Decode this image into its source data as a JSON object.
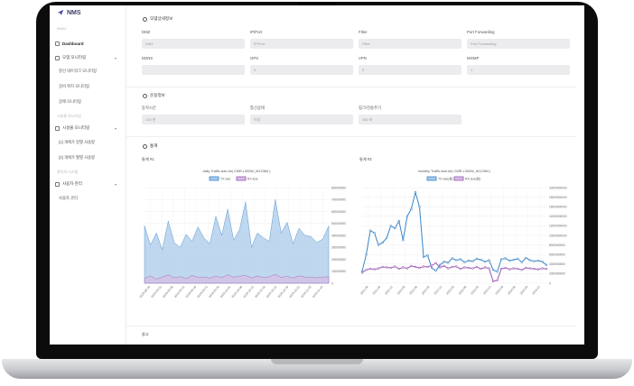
{
  "app": {
    "name": "NMS"
  },
  "sidebar": {
    "sections": [
      "MAIN",
      "시설물 모니터링",
      "관리자 시스템"
    ],
    "items": [
      {
        "label": "Dashboard"
      },
      {
        "label": "모뎀 모니터링"
      },
      {
        "label": "시설물 모니터링"
      },
      {
        "label": "사용자 관리"
      }
    ],
    "subitems": [
      "항선 네트워크 모니터링",
      "장비 위치 모니터링",
      "장애 모니터링",
      "[1] 개체가 일별 사용량",
      "[2] 개체가 월별 사용량",
      "사용자 관리"
    ]
  },
  "device_info": {
    "title": "모뎀상세정보",
    "fields": [
      {
        "label": "DMZ",
        "value": "DMZ"
      },
      {
        "label": "IP/Port",
        "value": "IP/Port"
      },
      {
        "label": "Filter",
        "value": "Filter"
      },
      {
        "label": "Port Forwarding",
        "value": "Port Forwarding"
      },
      {
        "label": "DDNS",
        "value": "..."
      },
      {
        "label": "GPS",
        "value": "0"
      },
      {
        "label": "VPN",
        "value": "0"
      },
      {
        "label": "MGMP",
        "value": "1"
      }
    ]
  },
  "operation": {
    "title": "운용정보",
    "fields": [
      {
        "label": "동작시간",
        "value": "120 분"
      },
      {
        "label": "통신상태",
        "value": "이상"
      },
      {
        "label": "링크/전송주기",
        "value": "180 초"
      }
    ]
  },
  "stats": {
    "title": "통계",
    "chart1_label": "통계 #1",
    "chart2_label": "통계 #2",
    "notes_label": "참고"
  },
  "colors": {
    "tx": "#3a86c8",
    "rx": "#9b59b6",
    "tx_fill": "#a9c9ea",
    "rx_fill": "#d6bfe4"
  },
  "chart_data": [
    {
      "type": "area",
      "title": "daily Traffic size-kb( CMR-L300W_W12384 )",
      "legend": [
        "TX size",
        "RX size"
      ],
      "legend_position": "top",
      "ylim": [
        0,
        800000000
      ],
      "yticks": [
        "800000000",
        "700000000",
        "600000000",
        "500000000",
        "400000000",
        "300000000",
        "200000000",
        "100000000",
        "0"
      ],
      "x_tick_labels": [
        "2024-08-26",
        "2024-09-01",
        "2024-09-06",
        "2024-09-11",
        "2024-09-16",
        "2024-09-21",
        "2024-09-26",
        "2024-10-01",
        "2024-10-06",
        "2024-10-11",
        "2024-10-16",
        "2024-10-21",
        "2024-10-26",
        "2024-10-31",
        "2024-11-05",
        "2024-11-10"
      ],
      "series": [
        {
          "name": "TX size",
          "values": [
            480000000,
            320000000,
            420000000,
            280000000,
            520000000,
            340000000,
            300000000,
            410000000,
            350000000,
            470000000,
            380000000,
            330000000,
            560000000,
            400000000,
            620000000,
            360000000,
            450000000,
            680000000,
            300000000,
            420000000,
            380000000,
            350000000,
            700000000,
            420000000,
            510000000,
            330000000,
            460000000,
            400000000,
            390000000,
            340000000,
            370000000,
            480000000
          ]
        },
        {
          "name": "RX size",
          "values": [
            40000000,
            60000000,
            35000000,
            50000000,
            70000000,
            45000000,
            55000000,
            38000000,
            65000000,
            48000000,
            52000000,
            42000000,
            60000000,
            46000000,
            72000000,
            50000000,
            58000000,
            66000000,
            44000000,
            61000000,
            47000000,
            53000000,
            75000000,
            49000000,
            57000000,
            43000000,
            62000000,
            51000000,
            48000000,
            45000000,
            50000000,
            55000000
          ]
        }
      ]
    },
    {
      "type": "line",
      "title": "monthly Traffic size-kb( CMR-L300W_W12384 )",
      "legend": [
        "TX size(월)",
        "RX size(월)"
      ],
      "legend_position": "top",
      "ylim": [
        0,
        20000000000
      ],
      "yticks": [
        "20000000000",
        "18000000000",
        "16000000000",
        "14000000000",
        "12000000000",
        "10000000000",
        "8000000000",
        "6000000000",
        "4000000000",
        "2000000000",
        "0"
      ],
      "x_tick_labels": [
        "2021-06",
        "2021-09",
        "2021-12",
        "2022-03",
        "2022-06",
        "2022-09",
        "2022-12",
        "2023-03",
        "2023-06",
        "2023-09",
        "2023-12",
        "2024-03",
        "2024-06",
        "2024-09",
        "2024-12"
      ],
      "series": [
        {
          "name": "TX size(월)",
          "values": [
            2500000000,
            6000000000,
            11000000000,
            10500000000,
            8000000000,
            8500000000,
            9500000000,
            12000000000,
            11500000000,
            13000000000,
            9000000000,
            14000000000,
            15500000000,
            19000000000,
            16000000000,
            5500000000,
            5800000000,
            3200000000,
            2600000000,
            3800000000,
            4500000000,
            4300000000,
            5200000000,
            4800000000,
            5000000000,
            4400000000,
            4700000000,
            4600000000,
            5100000000,
            4900000000,
            4500000000,
            4800000000,
            2800000000,
            2400000000,
            5000000000,
            5200000000,
            4700000000,
            4900000000,
            5100000000,
            4400000000,
            5300000000,
            4800000000,
            4600000000,
            4700000000,
            4500000000,
            3800000000
          ]
        },
        {
          "name": "RX size(월)",
          "values": [
            2200000000,
            2800000000,
            3000000000,
            2900000000,
            3100000000,
            3400000000,
            3300000000,
            3200000000,
            3500000000,
            3000000000,
            3300000000,
            3100000000,
            3600000000,
            3400000000,
            3200000000,
            3500000000,
            3400000000,
            3700000000,
            4200000000,
            3300000000,
            3600000000,
            3100000000,
            3400000000,
            3500000000,
            3000000000,
            3300000000,
            3200000000,
            3100000000,
            3400000000,
            3000000000,
            3300000000,
            3100000000,
            400000000,
            600000000,
            3000000000,
            3200000000,
            2900000000,
            3100000000,
            3000000000,
            2800000000,
            3200000000,
            3100000000,
            3000000000,
            2900000000,
            3100000000,
            3000000000
          ]
        }
      ]
    }
  ]
}
